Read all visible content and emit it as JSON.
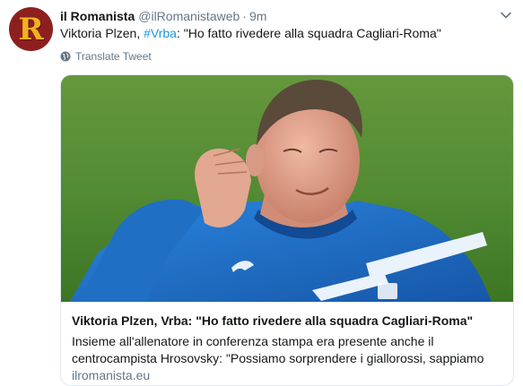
{
  "author": {
    "display_name": "il Romanista",
    "handle": "@ilRomanistaweb",
    "separator": "·",
    "time": "9m",
    "avatar_letter": "R"
  },
  "tweet": {
    "text_before": "Viktoria Plzen, ",
    "hashtag": "#Vrba",
    "text_after": ": \"Ho fatto rivedere alla squadra Cagliari-Roma\""
  },
  "translate_label": "Translate Tweet",
  "card": {
    "title": "Viktoria Plzen, Vrba: \"Ho fatto rivedere alla squadra Cagliari-Roma\"",
    "description_line1": "Insieme all'allenatore in conferenza stampa era presente anche il",
    "description_line2": "centrocampista Hrosovsky: \"Possiamo sorprendere i giallorossi, sappiamo",
    "domain": "ilromanista.eu"
  },
  "colors": {
    "link": "#1b95e0",
    "muted": "#657786",
    "avatar_bg": "#8e1f1f",
    "avatar_letter": "#f2b21d",
    "pitch": "#4f8a2f",
    "jersey": "#1f6fc4"
  },
  "icons": {
    "caret": "chevron-down-icon",
    "globe": "globe-icon"
  }
}
